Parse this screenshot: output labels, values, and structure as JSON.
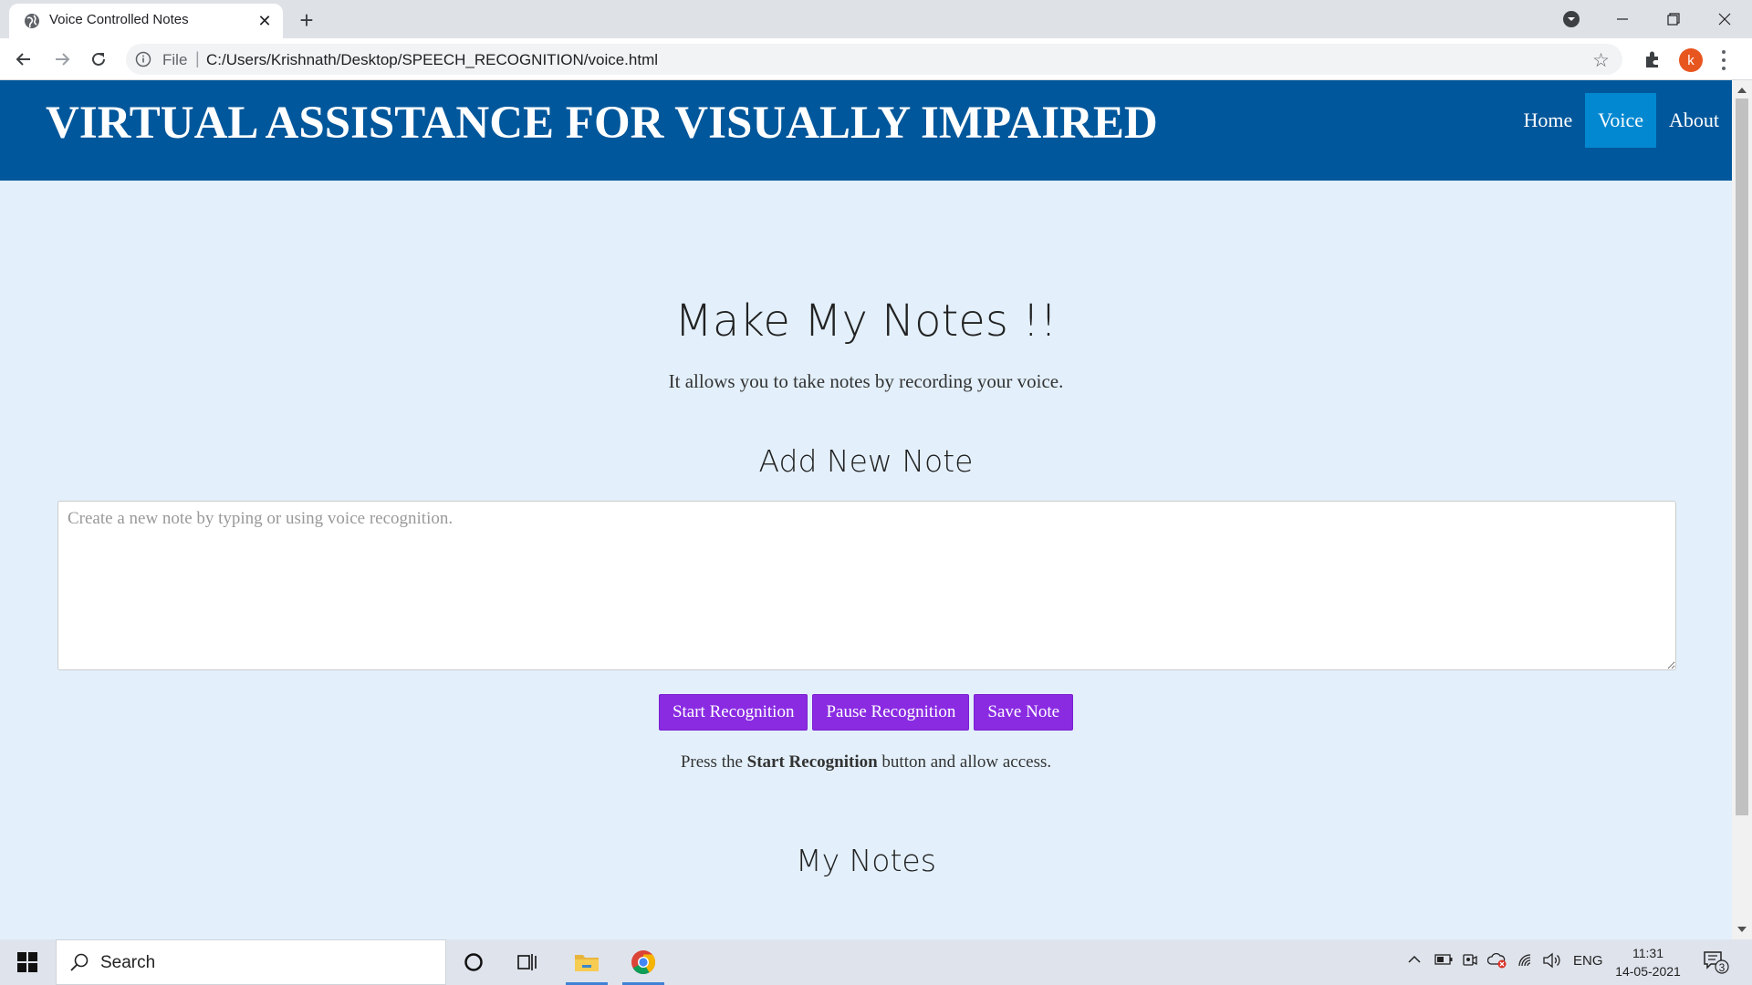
{
  "browser": {
    "tab_title": "Voice Controlled Notes",
    "scheme_label": "File",
    "url": "C:/Users/Krishnath/Desktop/SPEECH_RECOGNITION/voice.html",
    "profile_initial": "k"
  },
  "site": {
    "title": "VIRTUAL ASSISTANCE FOR VISUALLY IMPAIRED",
    "nav": [
      {
        "label": "Home",
        "active": false
      },
      {
        "label": "Voice",
        "active": true
      },
      {
        "label": "About",
        "active": false
      }
    ]
  },
  "main": {
    "heading": "Make My Notes !!",
    "subtitle": "It allows you to take notes by recording your voice.",
    "add_heading": "Add New Note",
    "note_placeholder": "Create a new note by typing or using voice recognition.",
    "buttons": {
      "start": "Start Recognition",
      "pause": "Pause Recognition",
      "save": "Save Note"
    },
    "help": {
      "prefix": "Press the ",
      "bold": "Start Recognition",
      "suffix": " button and allow access."
    },
    "my_notes_heading": "My Notes"
  },
  "taskbar": {
    "search_label": "Search",
    "language": "ENG",
    "time": "11:31",
    "date": "14-05-2021",
    "notification_count": "3"
  },
  "colors": {
    "header_bg": "#01579b",
    "nav_active_bg": "#0288d1",
    "page_bg": "#e3f0fb",
    "button_bg": "#8a2be2"
  }
}
